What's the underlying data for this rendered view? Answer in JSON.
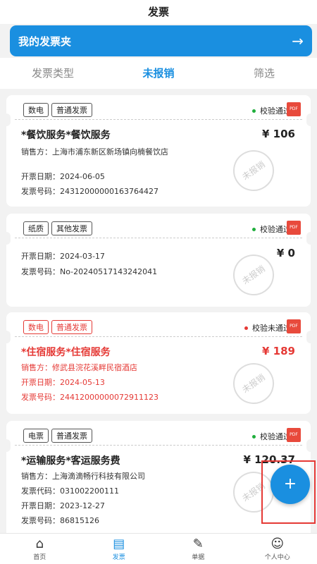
{
  "header": {
    "title": "发票"
  },
  "folder": {
    "label": "我的发票夹",
    "arrow": "→"
  },
  "tabs": [
    {
      "label": "发票类型",
      "active": false
    },
    {
      "label": "未报销",
      "active": true
    },
    {
      "label": "筛选",
      "active": false
    }
  ],
  "stamp_text": "未报销",
  "cards": [
    {
      "tags": [
        "数电",
        "普通发票"
      ],
      "status": "校验通过",
      "service": "*餐饮服务*餐饮服务",
      "amount": "¥ 106",
      "lines": [
        "销售方：上海市浦东新区新场镇向楠餐饮店",
        "开票日期：2024-06-05",
        "发票号码：24312000000163764427"
      ]
    },
    {
      "tags": [
        "纸质",
        "其他发票"
      ],
      "status": "校验通过",
      "service": "",
      "amount": "¥ 0",
      "lines": [
        "开票日期：2024-03-17",
        "发票号码：No-20240517143242041"
      ]
    },
    {
      "tags": [
        "数电",
        "普通发票"
      ],
      "status": "校验未通过",
      "service": "*住宿服务*住宿服务",
      "amount": "¥ 189",
      "lines": [
        "销售方：修武县浣花溪畔民宿酒店",
        "开票日期：2024-05-13",
        "发票号码：24412000000072911123"
      ]
    },
    {
      "tags": [
        "电票",
        "普通发票"
      ],
      "status": "校验通过",
      "service": "*运输服务*客运服务费",
      "amount": "¥ 120.37",
      "lines": [
        "销售方：上海滴滴畅行科技有限公司",
        "发票代码：031002200111",
        "开票日期：2023-12-27",
        "发票号码：86815126"
      ]
    }
  ],
  "pdf_label": "PDF",
  "fab": {
    "label": "+"
  },
  "tabbar": [
    {
      "label": "首页",
      "icon": "home-icon",
      "glyph": "⌂",
      "active": false
    },
    {
      "label": "发票",
      "icon": "invoice-icon",
      "glyph": "▤",
      "active": true
    },
    {
      "label": "单据",
      "icon": "document-icon",
      "glyph": "✎",
      "active": false
    },
    {
      "label": "个人中心",
      "icon": "person-icon",
      "glyph": "☺",
      "active": false
    }
  ]
}
